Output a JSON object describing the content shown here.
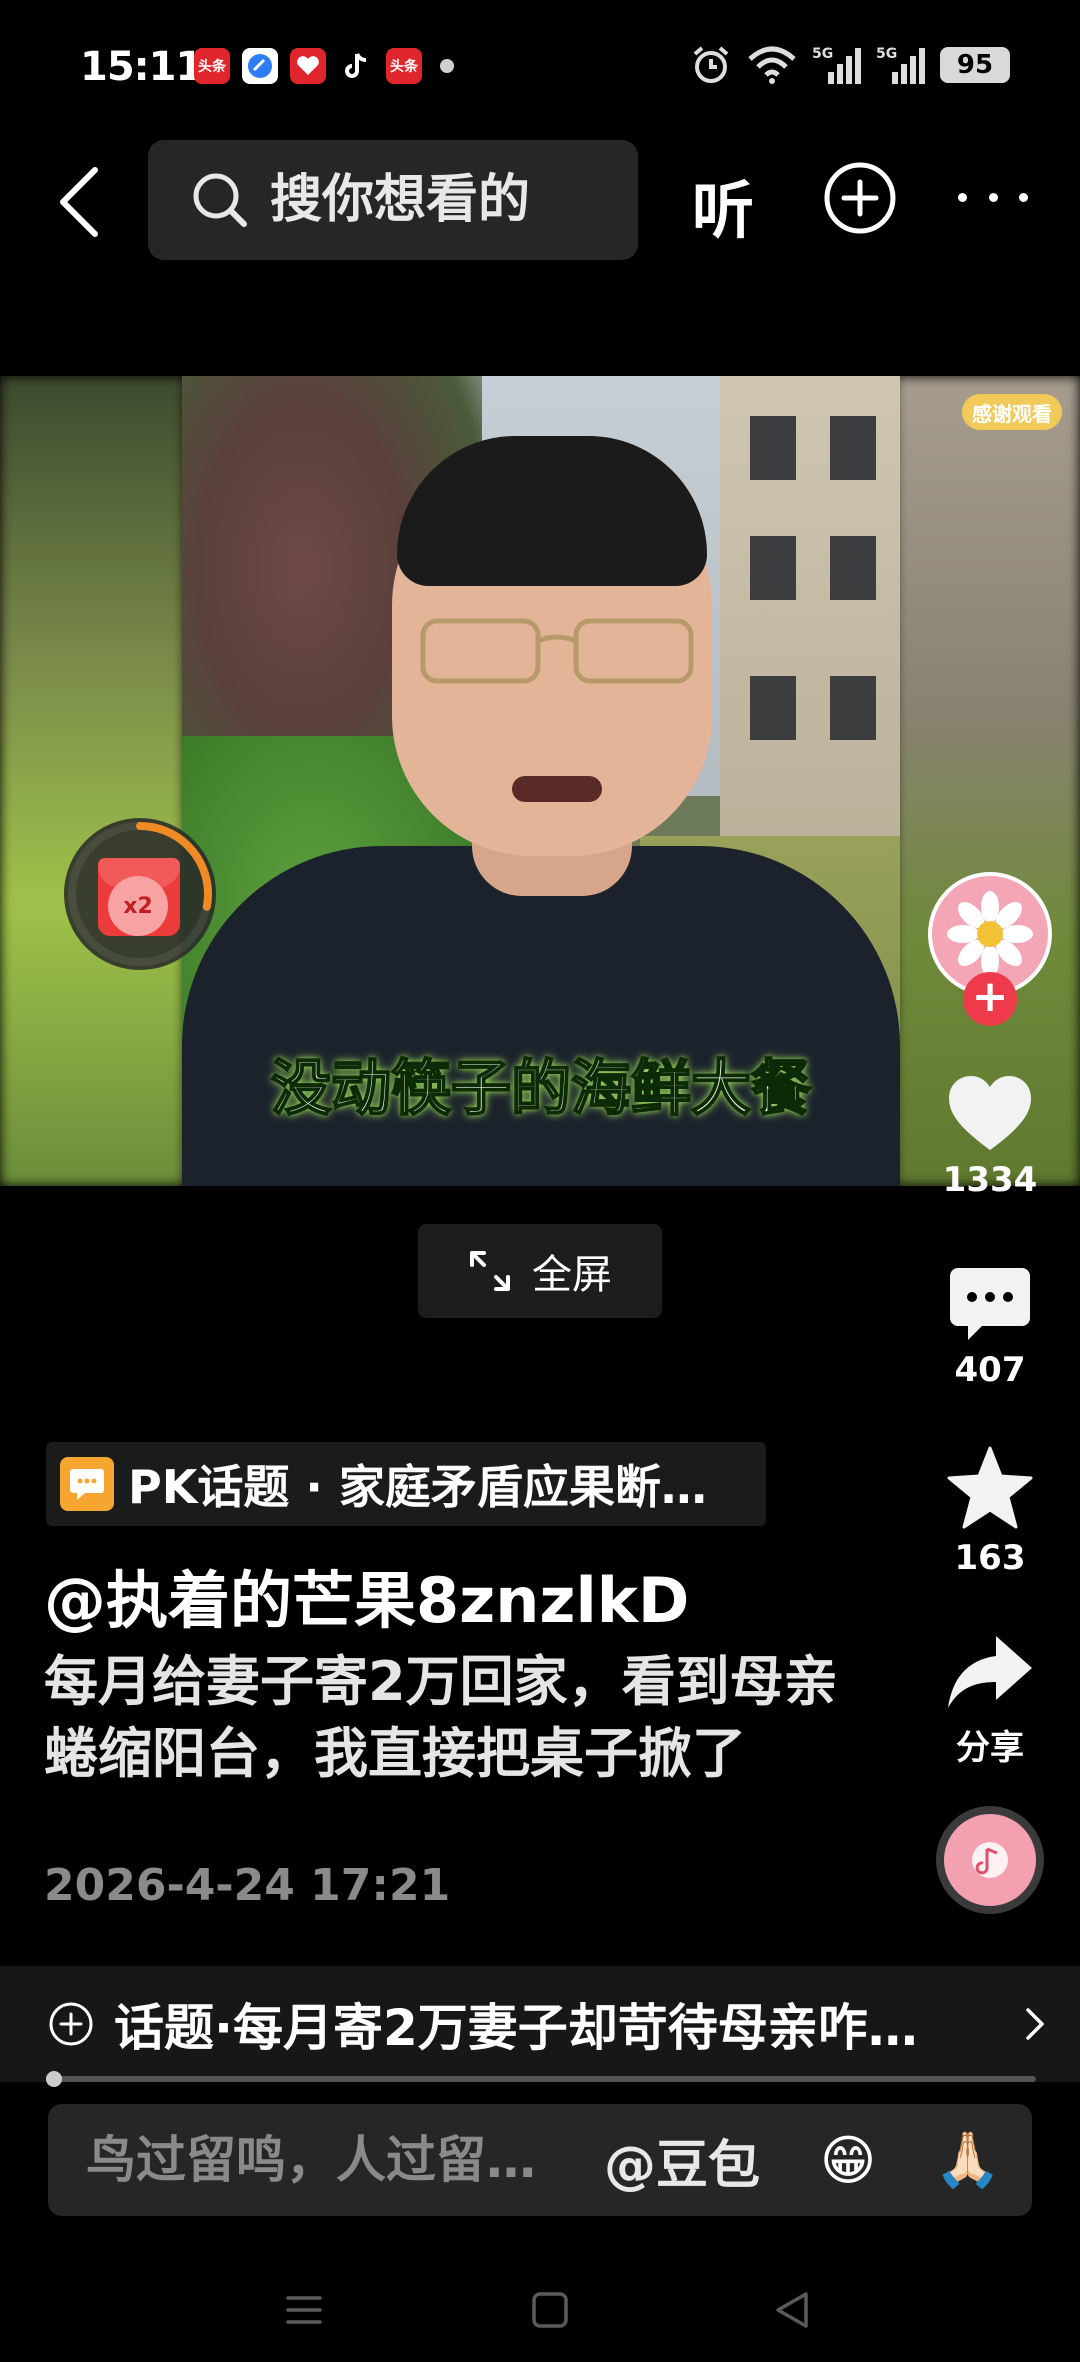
{
  "status_bar": {
    "time": "15:11",
    "notification_icons": [
      "toutiao-icon",
      "browser-icon",
      "tmall-icon",
      "tiktok-icon",
      "toutiao-lite-icon"
    ],
    "notification_labels": {
      "toutiao": "头条",
      "toutiao_lite": "头条"
    },
    "battery": "95"
  },
  "top_nav": {
    "search_placeholder": "搜你想看的",
    "listen_label": "听"
  },
  "video": {
    "subtitle": "没动筷子的海鲜大餐",
    "watermark": "感谢观看",
    "red_packet_multiplier": "x2",
    "red_packet_progress": 0.28,
    "fullscreen_label": "全屏"
  },
  "actions": {
    "follow_label": "+",
    "like_count": "1334",
    "comment_count": "407",
    "favorite_count": "163",
    "share_label": "分享"
  },
  "caption": {
    "pk_topic": "PK话题 · 家庭矛盾应果断…",
    "author": "@执着的芒果8znzlkD",
    "description": "每月给妻子寄2万回家，看到母亲蜷缩阳台，我直接把桌子掀了",
    "date": "2026-4-24 17:21"
  },
  "topic_bar": {
    "text": "话题·每月寄2万妻子却苛待母亲咋…"
  },
  "playback": {
    "progress": 0.005
  },
  "comment_bar": {
    "placeholder": "鸟过留鸣，人过留…",
    "mention": "@豆包",
    "emoji_1": "😁",
    "emoji_2": "🙏🏻"
  },
  "colors": {
    "background": "#000000",
    "accent_red": "#ef3a4b",
    "pk_orange": "#f7a531"
  }
}
